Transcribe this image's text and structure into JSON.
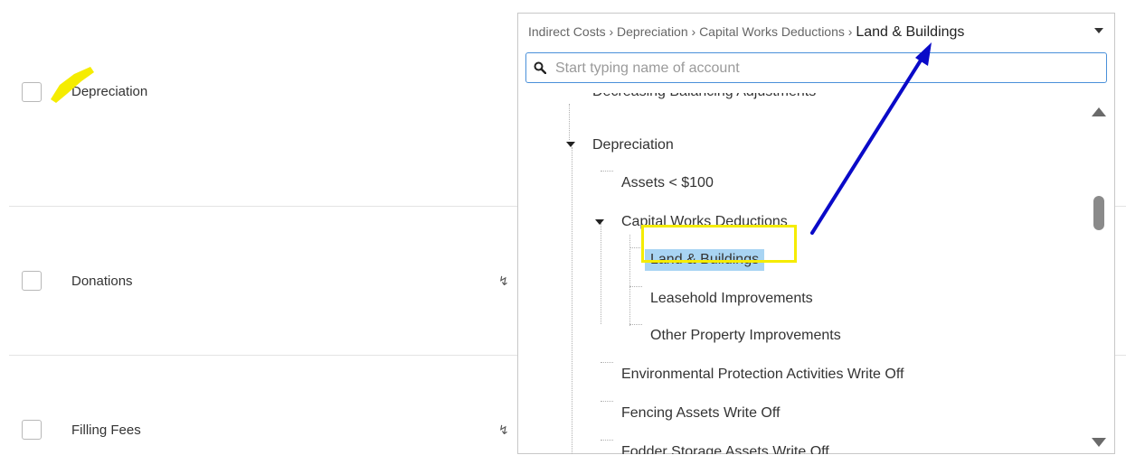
{
  "rows": [
    {
      "label": "Depreciation"
    },
    {
      "label": "Donations",
      "icon": "bolt-icon"
    },
    {
      "label": "Filling Fees",
      "icon": "bolt-icon"
    }
  ],
  "dropdown": {
    "breadcrumb_path": "Indirect Costs › Depreciation › Capital Works Deductions ›",
    "breadcrumb_current": "Land & Buildings",
    "search_placeholder": "Start typing name of account",
    "tree": {
      "partial_top": "Decreasing Balancing Adjustments",
      "depreciation": "Depreciation",
      "assets": "Assets < $100",
      "capital_works": "Capital Works Deductions",
      "land": "Land & Buildings",
      "leasehold": "Leasehold Improvements",
      "other_property": "Other Property Improvements",
      "environmental": "Environmental Protection Activities Write Off",
      "fencing": "Fencing Assets Write Off",
      "fodder": "Fodder Storage Assets Write Off"
    }
  },
  "colors": {
    "selected_bg": "#a8d4f3",
    "highlight_box": "#f5ec00",
    "arrow": "#0a0ac8"
  }
}
